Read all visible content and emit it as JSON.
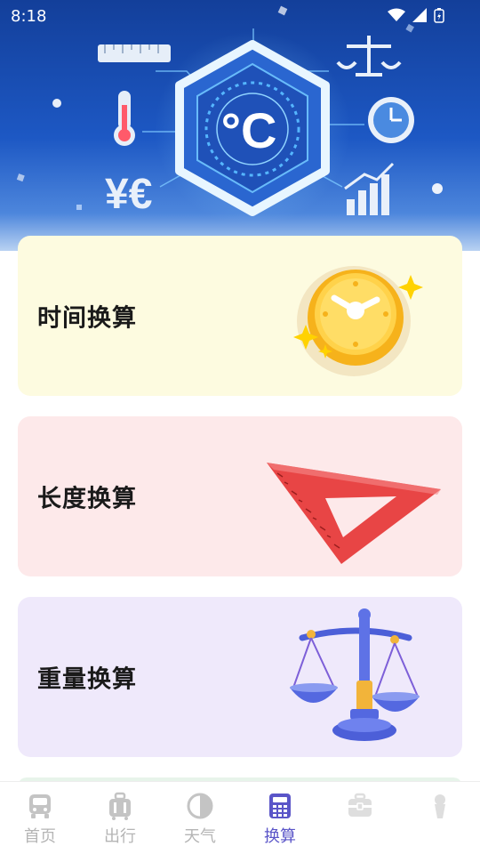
{
  "status_bar": {
    "time": "8:18"
  },
  "cards": {
    "time": {
      "label": "时间换算",
      "icon": "clock-icon"
    },
    "length": {
      "label": "长度换算",
      "icon": "ruler-triangle-icon"
    },
    "weight": {
      "label": "重量换算",
      "icon": "balance-scale-icon"
    }
  },
  "banner": {
    "unit_symbol": "°C",
    "currency_symbols": "¥€"
  },
  "nav": {
    "items": [
      {
        "label": "首页",
        "icon": "bus-icon",
        "active": false
      },
      {
        "label": "出行",
        "icon": "luggage-icon",
        "active": false
      },
      {
        "label": "天气",
        "icon": "half-circle-icon",
        "active": false
      },
      {
        "label": "换算",
        "icon": "calculator-icon",
        "active": true
      },
      {
        "label": "",
        "icon": "toolbox-icon",
        "active": false
      },
      {
        "label": "",
        "icon": "person-icon",
        "active": false
      }
    ]
  },
  "colors": {
    "accent": "#5a55c8",
    "inactive": "#b5b5b5",
    "time_card": "#fdfbe0",
    "length_card": "#fde9ea",
    "weight_card": "#efe9fb"
  }
}
